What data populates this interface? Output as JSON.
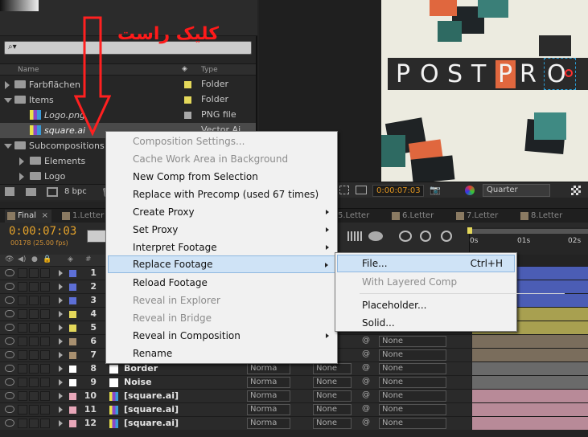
{
  "annotation": {
    "text": "کلیک راست",
    "color": "#ff2020"
  },
  "project": {
    "col_name": "Name",
    "col_type": "Type",
    "items": [
      {
        "name": "Farbflächen",
        "type": "Folder",
        "kind": "folder"
      },
      {
        "name": "Items",
        "type": "Folder",
        "kind": "folder"
      },
      {
        "name": "Logo.png",
        "type": "PNG file",
        "kind": "file"
      },
      {
        "name": "square.ai",
        "type": "Vector Ai",
        "kind": "file"
      },
      {
        "name": "Subcompositions",
        "type": "Folder",
        "kind": "folder"
      },
      {
        "name": "Elements",
        "type": "",
        "kind": "folder"
      },
      {
        "name": "Logo",
        "type": "",
        "kind": "folder"
      }
    ],
    "bpc": "8 bpc"
  },
  "composition": {
    "logo_letters": [
      "P",
      "O",
      "S",
      "T",
      "P",
      "R",
      "O"
    ],
    "timecode": "0:00:07:03",
    "resolution": "Quarter"
  },
  "timeline": {
    "tabs": [
      "Final",
      "1.Letter",
      "5.Letter",
      "6.Letter",
      "7.Letter",
      "8.Letter"
    ],
    "timecode": "0:00:07:03",
    "fps": "00178 (25.00 fps)",
    "ruler": [
      "0s",
      "01s",
      "02s"
    ],
    "hash": "#",
    "layers": [
      {
        "num": "1",
        "name": "",
        "color": "#5d6fd6",
        "bar": "#4b5db5"
      },
      {
        "num": "2",
        "name": "",
        "color": "#5d6fd6",
        "bar": "#4b5db5"
      },
      {
        "num": "3",
        "name": "",
        "color": "#5d6fd6",
        "bar": "#4b5db5"
      },
      {
        "num": "4",
        "name": "",
        "color": "#e4d85a",
        "bar": "#a8a050"
      },
      {
        "num": "5",
        "name": "",
        "color": "#e4d85a",
        "bar": "#a8a050"
      },
      {
        "num": "6",
        "name": "",
        "color": "#a89070",
        "bar": "#7a6d5c",
        "mode": "",
        "trk": "",
        "par": "None"
      },
      {
        "num": "7",
        "name": "",
        "color": "#a89070",
        "bar": "#7a6d5c",
        "mode": "",
        "trk": "",
        "par": "None"
      },
      {
        "num": "8",
        "name": "Border",
        "color": "#ffffff",
        "bar": "#6a6a6a",
        "mode": "Norma",
        "trk": "None",
        "par": "None"
      },
      {
        "num": "9",
        "name": "Noise",
        "color": "#ffffff",
        "bar": "#6a6a6a",
        "mode": "Norma",
        "trk": "None",
        "par": "None"
      },
      {
        "num": "10",
        "name": "[square.ai]",
        "color": "#e8a7b9",
        "bar": "#b88a98",
        "mode": "Norma",
        "trk": "None",
        "par": "None"
      },
      {
        "num": "11",
        "name": "[square.ai]",
        "color": "#e8a7b9",
        "bar": "#b88a98",
        "mode": "Norma",
        "trk": "None",
        "par": "None"
      },
      {
        "num": "12",
        "name": "[square.ai]",
        "color": "#e8a7b9",
        "bar": "#b88a98",
        "mode": "Norma",
        "trk": "None",
        "par": "None"
      }
    ]
  },
  "context_menu": {
    "items": [
      {
        "label": "Composition Settings...",
        "disabled": true
      },
      {
        "label": "Cache Work Area in Background",
        "disabled": true
      },
      {
        "label": "New Comp from Selection",
        "disabled": false
      },
      {
        "label": "Replace with Precomp (used 67 times)",
        "disabled": false
      },
      {
        "label": "Create Proxy",
        "disabled": false,
        "submenu": true
      },
      {
        "label": "Set Proxy",
        "disabled": false,
        "submenu": true
      },
      {
        "label": "Interpret Footage",
        "disabled": false,
        "submenu": true
      },
      {
        "label": "Replace Footage",
        "disabled": false,
        "submenu": true,
        "highlighted": true
      },
      {
        "label": "Reload Footage",
        "disabled": false
      },
      {
        "label": "Reveal in Explorer",
        "disabled": true
      },
      {
        "label": "Reveal in Bridge",
        "disabled": true
      },
      {
        "label": "Reveal in Composition",
        "disabled": false,
        "submenu": true
      },
      {
        "label": "Rename",
        "disabled": false
      }
    ],
    "submenu": [
      {
        "label": "File...",
        "shortcut": "Ctrl+H",
        "highlighted": true
      },
      {
        "label": "With Layered Comp",
        "disabled": true
      },
      {
        "label": "Placeholder...",
        "disabled": false
      },
      {
        "label": "Solid...",
        "disabled": false
      }
    ]
  }
}
